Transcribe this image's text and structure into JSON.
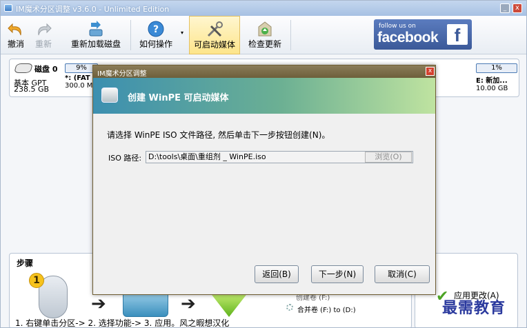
{
  "window": {
    "title": "IM魔术分区调整 v3.6.0 - Unlimited Edition",
    "min_glyph": "_",
    "close_glyph": "x"
  },
  "toolbar": {
    "items": [
      {
        "label": "撤消",
        "icon": "undo-icon"
      },
      {
        "label": "重新",
        "icon": "redo-icon"
      },
      {
        "label": "重新加载磁盘",
        "icon": "reload-disk-icon"
      },
      {
        "label": "如何操作",
        "icon": "help-icon"
      },
      {
        "label": "可启动媒体",
        "icon": "tools-icon"
      },
      {
        "label": "检查更新",
        "icon": "update-icon"
      }
    ],
    "facebook": {
      "line1": "follow us on",
      "line2": "facebook",
      "glyph": "f"
    }
  },
  "disk": {
    "name": "磁盘 0",
    "type": "基本 GPT",
    "size": "238.5 GB",
    "partitions": [
      {
        "percent": "9%",
        "label": "*: (FAT",
        "size": "300.0 M"
      },
      {
        "percent": "1%",
        "label": "E: 新加...",
        "size": "10.00 GB"
      }
    ]
  },
  "steps": {
    "heading": "步骤",
    "number": "1",
    "text": "1. 右键单击分区-> 2. 选择功能-> 3. 应用。风之暇想汉化",
    "pending_ops": [
      "创建卷 (F:)",
      "合并卷 (F:) to (D:)"
    ]
  },
  "apply": {
    "label": "应用更改(A)"
  },
  "watermark": "最需教育",
  "dialog": {
    "title": "IM魔术分区调整",
    "banner_title": "创建 WinPE 可启动媒体",
    "instruction": "请选择 WinPE ISO 文件路径, 然后单击下一步按钮创建(N)。",
    "iso_label": "ISO 路径:",
    "iso_value": "D:\\tools\\桌面\\重组剂 _ WinPE.iso",
    "browse": "浏览(O)",
    "back": "返回(B)",
    "next": "下一步(N)",
    "cancel": "取消(C)",
    "close_glyph": "x"
  }
}
